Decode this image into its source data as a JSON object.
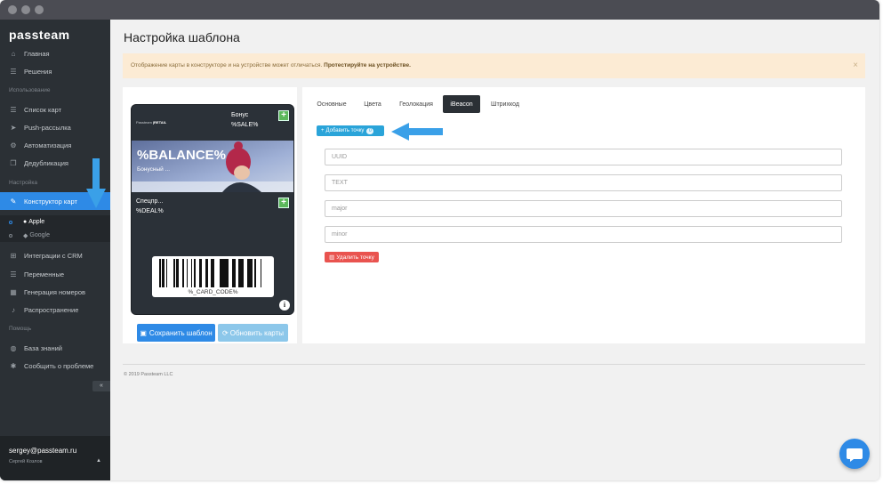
{
  "app": {
    "logo": "passteam"
  },
  "sidebar": {
    "items": [
      {
        "label": "Главная",
        "icon": "home-icon"
      },
      {
        "label": "Решения",
        "icon": "list-icon"
      },
      {
        "label": "Список карт",
        "icon": "list-icon"
      },
      {
        "label": "Push-рассылка",
        "icon": "send-icon"
      },
      {
        "label": "Автоматизация",
        "icon": "settings-icon"
      },
      {
        "label": "Дедубликация",
        "icon": "document-icon"
      },
      {
        "label": "Конструктор карт",
        "icon": "brush-icon",
        "active": true
      },
      {
        "label": "Интеграции с CRM",
        "icon": "sitemap-icon"
      },
      {
        "label": "Переменные",
        "icon": "list-icon"
      },
      {
        "label": "Генерация номеров",
        "icon": "grid-icon"
      },
      {
        "label": "Распространение",
        "icon": "bell-icon"
      },
      {
        "label": "База знаний",
        "icon": "globe-icon"
      },
      {
        "label": "Сообщить о проблеме",
        "icon": "bug-icon"
      }
    ],
    "sections": {
      "usage": "Использование",
      "settings": "Настройка",
      "help": "Помощь"
    },
    "sub_items": [
      {
        "label": "Apple",
        "icon": "apple-icon",
        "active": true
      },
      {
        "label": "Google",
        "icon": "diamond-icon",
        "active": false
      }
    ],
    "collapse": "«",
    "user": {
      "email": "sergey@passteam.ru",
      "name": "Сергей Козлов"
    }
  },
  "main": {
    "title": "Настройка шаблона",
    "alert": {
      "text": "Отображение карты в конструкторе и на устройстве может отличаться.",
      "bold": "Протестируйте на устройстве.",
      "close": "×"
    },
    "card": {
      "brand": "Passteam",
      "brand_suffix": "|RETAIL",
      "bonus_label": "Бонус",
      "bonus_value": "%SALE%",
      "balance": "%BALANCE%",
      "balance_sub": "Бонусный ...",
      "deal_label": "Спецпр...",
      "deal_value": "%DEAL%",
      "barcode_value": "%_CARD_CODE%",
      "info": "i"
    },
    "buttons": {
      "save": "Сохранить шаблон",
      "update": "Обновить карты"
    },
    "tabs": [
      {
        "label": "Основные"
      },
      {
        "label": "Цвета"
      },
      {
        "label": "Геолокация"
      },
      {
        "label": "iBeacon",
        "active": true
      },
      {
        "label": "Штрихкод"
      }
    ],
    "add_point": {
      "label": "Добавить точку",
      "count": "0"
    },
    "fields": {
      "uuid": "UUID",
      "text": "TEXT",
      "major": "major",
      "minor": "minor"
    },
    "delete_point": "Удалить точку",
    "copyright": "© 2019 Passteam LLC"
  },
  "colors": {
    "accent": "#2e8ae6",
    "sidebar_bg": "#2b3035",
    "alert_bg": "#fcebd4",
    "success": "#5cb85c",
    "danger": "#e9534f",
    "info": "#2aa4d9"
  }
}
